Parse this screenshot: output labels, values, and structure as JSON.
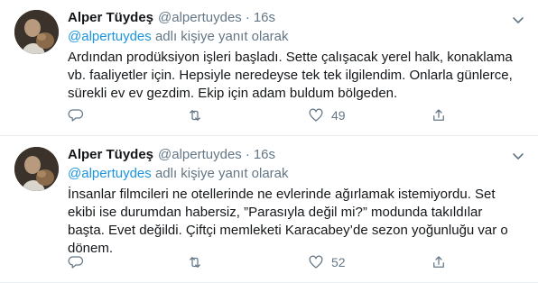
{
  "tweets": [
    {
      "author_name": "Alper Tüydeş",
      "handle": "@alpertuydes",
      "separator": "·",
      "time": "16s",
      "reply_mention": "@alpertuydes",
      "reply_suffix": " adlı kişiye yanıt olarak",
      "lines": [
        "Ardından prodüksiyon işleri başladı. Sette çalışacak yerel halk, konaklama",
        "vb. faaliyetler için. Hepsiyle neredeyse tek tek ilgilendim. Onlarla günlerce,",
        "sürekli ev ev gezdim. Ekip için adam buldum bölgeden."
      ],
      "like_count": "49"
    },
    {
      "author_name": "Alper Tüydeş",
      "handle": "@alpertuydes",
      "separator": "·",
      "time": "16s",
      "reply_mention": "@alpertuydes",
      "reply_suffix": " adlı kişiye yanıt olarak",
      "lines": [
        "İnsanlar filmcileri ne otellerinde ne evlerinde ağırlamak istemiyordu. Set",
        "ekibi ise durumdan habersiz, ”Parasıyla değil mi?” modunda takıldılar",
        "başta. Evet değildi. Çiftçi memleketi Karacabey’de sezon yoğunluğu var o",
        "dönem."
      ],
      "like_count": "52"
    }
  ],
  "icons": {
    "menu": "chevron-down-icon",
    "reply": "reply-icon",
    "retweet": "retweet-icon",
    "like": "heart-icon",
    "share": "share-icon"
  },
  "colors": {
    "text": "#14171a",
    "secondary": "#657786",
    "link": "#1b95e0",
    "divider": "#e6ecf0"
  }
}
